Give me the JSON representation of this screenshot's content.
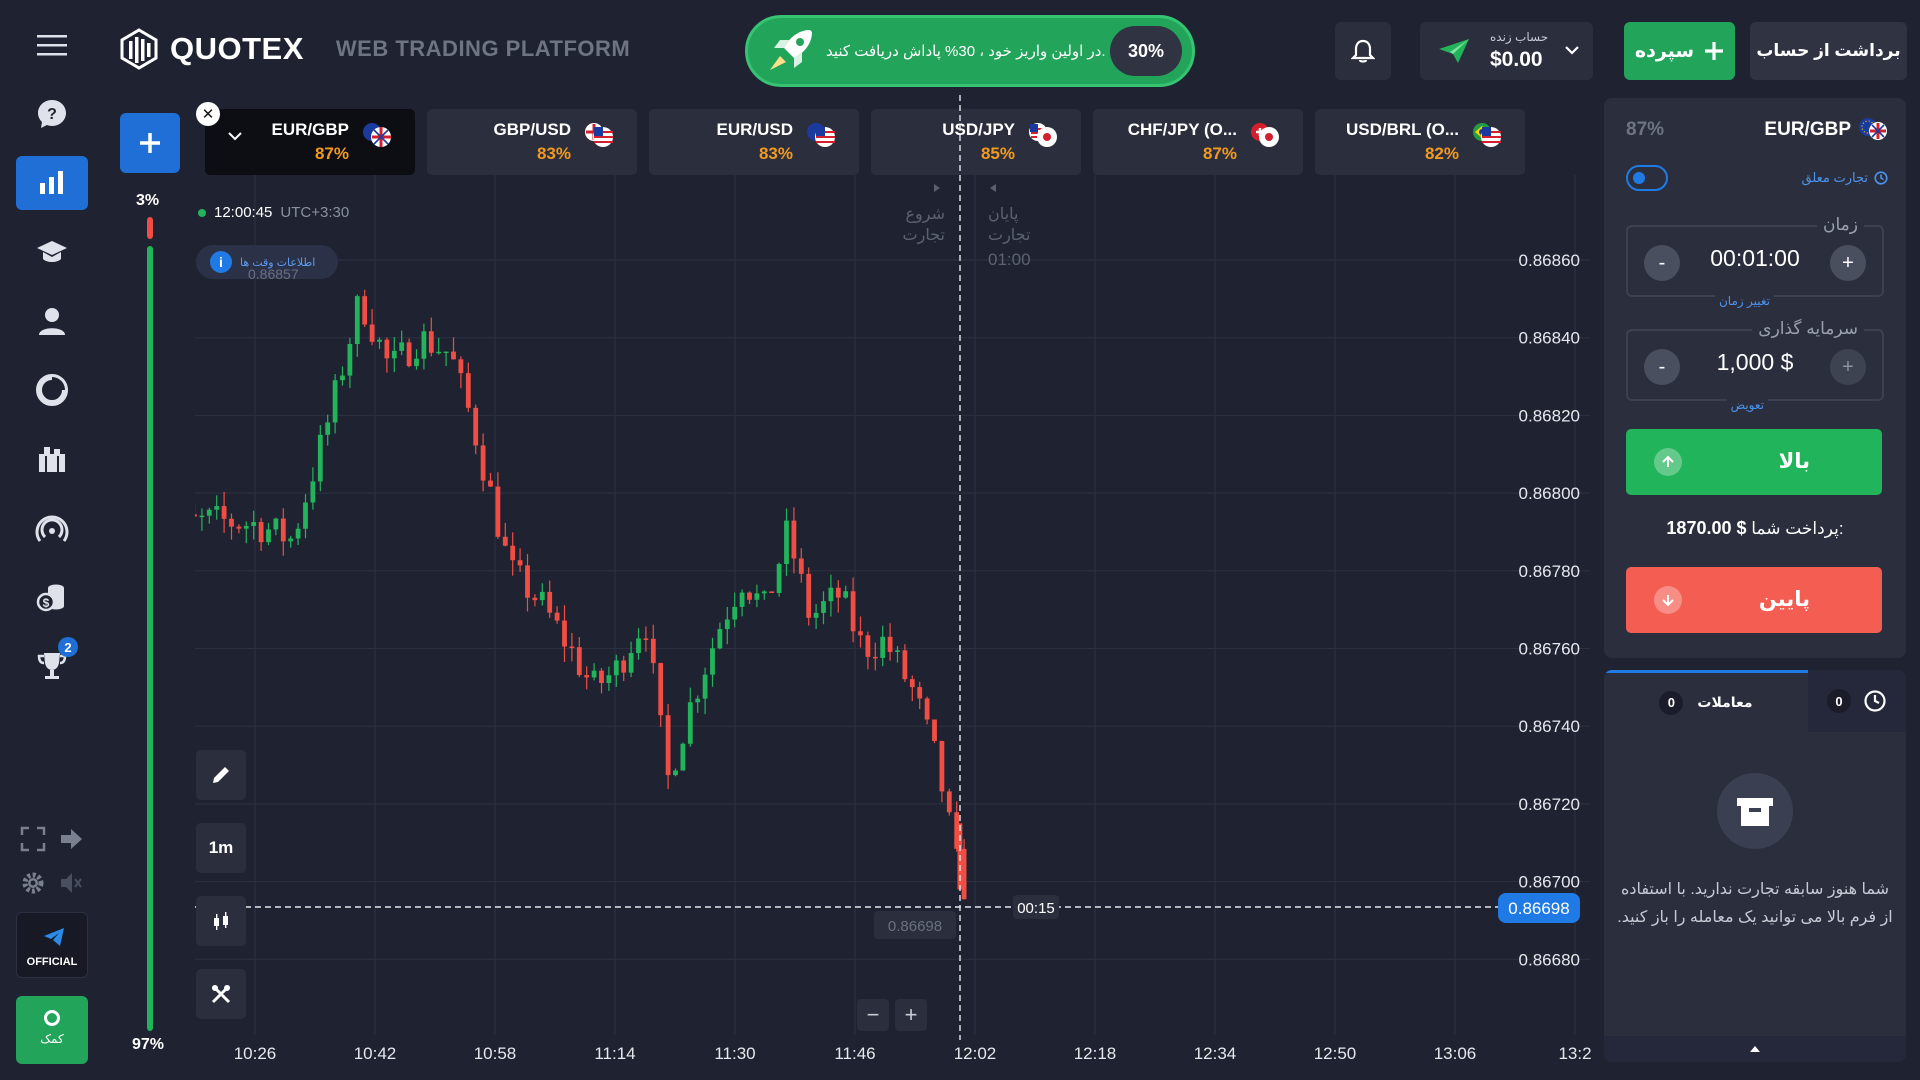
{
  "header": {
    "brand": "QUOTEX",
    "subtitle": "WEB TRADING PLATFORM",
    "promo_text": "در اولین واریز خود ، 30% پاداش دریافت کنید.",
    "promo_percent": "30%",
    "account_label": "حساب زنده",
    "account_balance": "$0.00",
    "deposit_label": "سپرده",
    "withdraw_label": "برداشت از حساب"
  },
  "sidebar": {
    "trophy_badge": "2",
    "official_label": "OFFICIAL",
    "help_label": "کمک",
    "icons": [
      "menu-icon",
      "help-icon",
      "chart-icon",
      "education-icon",
      "profile-icon",
      "analytics-icon",
      "market-icon",
      "signal-icon",
      "coins-icon",
      "trophy-icon",
      "fullscreen-icon",
      "logout-icon",
      "settings-icon",
      "sound-icon"
    ]
  },
  "tabs": [
    {
      "name": "EUR/GBP",
      "percent": "87%"
    },
    {
      "name": "GBP/USD",
      "percent": "83%"
    },
    {
      "name": "EUR/USD",
      "percent": "83%"
    },
    {
      "name": "USD/JPY",
      "percent": "85%"
    },
    {
      "name": "CHF/JPY (O...",
      "percent": "87%"
    },
    {
      "name": "USD/BRL (O...",
      "percent": "82%"
    }
  ],
  "sentiment": {
    "top": "3%",
    "bottom": "97%"
  },
  "chart": {
    "time": "12:00:45",
    "timezone": "UTC+3:30",
    "info_chip": "اطلاعات وقت ها",
    "high_marker": "0.86857",
    "start_label_1": "شروع",
    "start_label_2": "تجارت",
    "end_label_1": "پایان",
    "end_label_2": "تجارت",
    "end_time": "01:00",
    "current_price": "0.86698",
    "price_tag_left": "0.86698",
    "countdown": "00:15",
    "timeframe": "1m",
    "zoom_out": "−",
    "zoom_in": "+"
  },
  "chart_data": {
    "type": "candlestick",
    "title": "",
    "y_ticks": [
      "0.86860",
      "0.86840",
      "0.86820",
      "0.86800",
      "0.86780",
      "0.86760",
      "0.86740",
      "0.86720",
      "0.86700",
      "0.86680"
    ],
    "x_ticks": [
      "10:26",
      "10:42",
      "10:58",
      "11:14",
      "11:30",
      "11:46",
      "12:02",
      "12:18",
      "12:34",
      "12:50",
      "13:06",
      "13:2"
    ],
    "ylim": [
      0.8667,
      0.8687
    ],
    "colors": {
      "up": "#22b45a",
      "down": "#f04d44"
    },
    "close_path": [
      [
        "10:13",
        0.8679
      ],
      [
        "10:20",
        0.86793
      ],
      [
        "10:26",
        0.86792
      ],
      [
        "10:31",
        0.86788
      ],
      [
        "10:36",
        0.8682
      ],
      [
        "10:40",
        0.8685
      ],
      [
        "10:44",
        0.86832
      ],
      [
        "10:48",
        0.8684
      ],
      [
        "10:52",
        0.86836
      ],
      [
        "10:55",
        0.86818
      ],
      [
        "11:00",
        0.8678
      ],
      [
        "11:04",
        0.86772
      ],
      [
        "11:08",
        0.8676
      ],
      [
        "11:11",
        0.8675
      ],
      [
        "11:14",
        0.86754
      ],
      [
        "11:18",
        0.86768
      ],
      [
        "11:21",
        0.86726
      ],
      [
        "11:24",
        0.86745
      ],
      [
        "11:28",
        0.86766
      ],
      [
        "11:31",
        0.86778
      ],
      [
        "11:34",
        0.8677
      ],
      [
        "11:37",
        0.8679
      ],
      [
        "11:40",
        0.86768
      ],
      [
        "11:44",
        0.86774
      ],
      [
        "11:47",
        0.8676
      ],
      [
        "11:50",
        0.86762
      ],
      [
        "11:54",
        0.86748
      ],
      [
        "11:57",
        0.8673
      ],
      [
        "12:00",
        0.867
      ],
      [
        "12:01",
        0.86698
      ]
    ]
  },
  "panel": {
    "asset": "EUR/GBP",
    "percent": "87%",
    "closed_trade": "تجارت معلق",
    "time_label": "زمان",
    "time_value": "00:01:00",
    "time_link": "تغییر زمان",
    "investment_label": "سرمایه گذاری",
    "investment_value": "1,000 $",
    "investment_link": "تعویض",
    "up_label": "بالا",
    "payout_label": "پرداخت شما:",
    "payout_value": "1870.00 $",
    "down_label": "پایین",
    "minus": "-",
    "plus": "+"
  },
  "trades": {
    "tab_label": "معاملات",
    "tab_count": "0",
    "history_count": "0",
    "empty_text": "شما هنوز سابقه تجارت ندارید. با استفاده از فرم بالا می توانید یک معامله را باز کنید."
  }
}
